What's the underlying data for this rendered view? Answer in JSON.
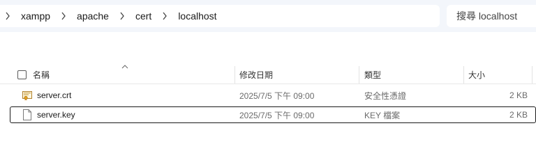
{
  "breadcrumb": {
    "segments": [
      "xampp",
      "apache",
      "cert",
      "localhost"
    ]
  },
  "search": {
    "placeholder": "搜尋 localhost"
  },
  "columns": {
    "name": "名稱",
    "modified": "修改日期",
    "type": "類型",
    "size": "大小"
  },
  "files": [
    {
      "name": "server.crt",
      "modified": "2025/7/5 下午 09:00",
      "type": "安全性憑證",
      "size": "2 KB",
      "icon": "certificate-file-icon"
    },
    {
      "name": "server.key",
      "modified": "2025/7/5 下午 09:00",
      "type": "KEY 檔案",
      "size": "2 KB",
      "icon": "file-icon"
    }
  ]
}
